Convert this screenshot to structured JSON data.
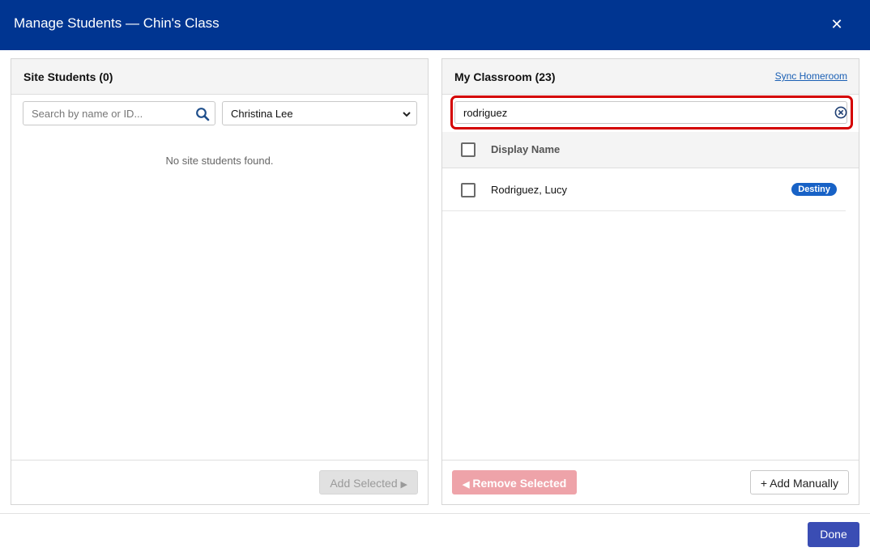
{
  "modal": {
    "title": "Manage Students — Chin's Class",
    "close_glyph": "✕",
    "done_label": "Done"
  },
  "site_students": {
    "title": "Site Students (0)",
    "search_placeholder": "Search by name or ID...",
    "search_value": "",
    "teacher_filter": "Christina Lee",
    "empty_message": "No site students found.",
    "add_selected_label": "Add Selected",
    "add_selected_arrow": "▶"
  },
  "classroom": {
    "title": "My Classroom (23)",
    "sync_label": "Sync Homeroom",
    "search_value": "rodriguez",
    "column_display_name": "Display Name",
    "rows": [
      {
        "name": "Rodriguez, Lucy",
        "badge": "Destiny"
      }
    ],
    "remove_selected_arrow": "◀",
    "remove_selected_label": "Remove Selected",
    "add_manually_label": "+ Add Manually"
  },
  "colors": {
    "header_bg": "#003591",
    "highlight_border": "#d40000",
    "badge_bg": "#1862c6",
    "done_bg": "#3a4db4",
    "remove_disabled_bg": "#eea3a9"
  },
  "icons": {
    "close": "close-icon",
    "search": "search-icon",
    "dropdown": "chevron-down-icon",
    "clear": "clear-circle-icon"
  }
}
